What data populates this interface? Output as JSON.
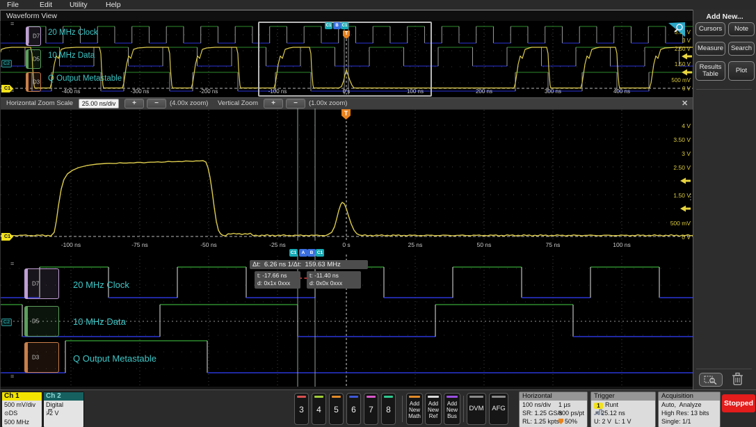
{
  "menu": {
    "items": [
      "File",
      "Edit",
      "Utility",
      "Help"
    ]
  },
  "view_title": "Waveform View",
  "icons": {
    "grip": "≡",
    "close": "✕",
    "dots": "⋮⋮⋮",
    "trigger": "T",
    "probe": "⊙"
  },
  "zoom_bar": {
    "h_label": "Horizontal Zoom Scale",
    "h_scale": "25.00 ns/div",
    "plus": "+",
    "minus": "−",
    "h_zoom": "(4.00x zoom)",
    "v_label": "Vertical Zoom",
    "v_zoom": "(1.00x zoom)"
  },
  "channels": [
    {
      "id": "D7",
      "name": "20 MHz Clock",
      "color": "#bf9fd4"
    },
    {
      "id": "D5",
      "name": "10 MHz Data",
      "color": "#5d9e5d"
    },
    {
      "id": "D3",
      "name": "Q Output Metastable",
      "color": "#c97f4a"
    }
  ],
  "markers": {
    "c1": "C1",
    "c2": "C2",
    "cursor_source": "C1",
    "cursor_a": "A",
    "cursor_b": "B"
  },
  "overview": {
    "ticks": [
      "-400 ns",
      "-300 ns",
      "-200 ns",
      "-100 ns",
      "0 s",
      "100 ns",
      "200 ns",
      "300 ns",
      "400 ns"
    ],
    "vlabels": [
      "3.50 V",
      "3 V",
      "2.50 V",
      "1.50 V",
      "500 mV",
      "0 V"
    ]
  },
  "main_view": {
    "ticks": [
      "-100 ns",
      "-75 ns",
      "-50 ns",
      "-25 ns",
      "0 s",
      "25 ns",
      "50 ns",
      "75 ns",
      "100 ns"
    ],
    "vlabels": [
      "4 V",
      "3.50 V",
      "3 V",
      "2.50 V",
      "1.50 V",
      "500 mV",
      "0 V"
    ]
  },
  "cursor_readout": {
    "dt": "Δt:  6.26 ns 1/Δt:  159.63 MHz",
    "a_t": "t: -17.66 ns",
    "a_d": "d: 0x1x 0xxx",
    "b_t": "t: -11.40 ns",
    "b_d": "d: 0x0x 0xxx"
  },
  "add_new_panel": {
    "title": "Add New...",
    "buttons": [
      "Cursors",
      "Note",
      "Measure",
      "Search",
      "Results Table",
      "Plot"
    ]
  },
  "bottom": {
    "ch1": {
      "title": "Ch 1",
      "scale": "500 mV/div",
      "probe": "DS",
      "bw": "500 MHz"
    },
    "ch2": {
      "title": "Ch 2",
      "mode": "Digital",
      "threshold": ": 2 V"
    },
    "channel_buttons": [
      {
        "label": "3",
        "color": "#d85050"
      },
      {
        "label": "4",
        "color": "#a0cc38"
      },
      {
        "label": "5",
        "color": "#e08a2a"
      },
      {
        "label": "6",
        "color": "#4058d8"
      },
      {
        "label": "7",
        "color": "#d858c8"
      },
      {
        "label": "8",
        "color": "#30c890"
      }
    ],
    "add_buttons": [
      {
        "label": "Add New Math",
        "color": "#e08a2a"
      },
      {
        "label": "Add New Ref",
        "color": "#d8d8d8"
      },
      {
        "label": "Add New Bus",
        "color": "#9a50e0"
      }
    ],
    "dvm": "DVM",
    "afg": "AFG",
    "horizontal": {
      "title": "Horizontal",
      "scale": "100 ns/div",
      "window": "1 µs",
      "sr": "SR: 1.25 GS/s",
      "res": "800 ps/pt",
      "rl": "RL: 1.25 kpts",
      "pos": "50%"
    },
    "trigger": {
      "title": "Trigger",
      "source": "1",
      "type": "Runt",
      "width": "< 25.12 ns",
      "levels": "U: 2 V  L: 1 V"
    },
    "acquisition": {
      "title": "Acquisition",
      "mode": "Auto,",
      "mode2": "Analyze",
      "detail": "High Res: 13 bits",
      "single": "Single: 1/1"
    },
    "stopped": "Stopped"
  }
}
